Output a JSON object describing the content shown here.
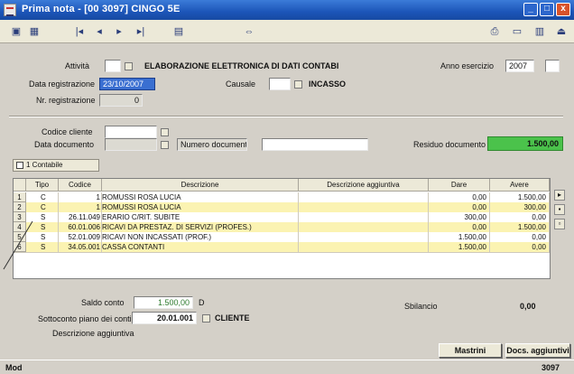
{
  "window": {
    "title": "Prima nota - [00 3097] CINGO 5E",
    "min_glyph": "_",
    "max_glyph": "□",
    "close_glyph": "x"
  },
  "toolbar": {
    "left_icons": [
      "save-icon",
      "window-icon",
      "first-record-icon",
      "previous-record-icon",
      "next-record-icon",
      "last-record-icon",
      "document-icon",
      "link-icon"
    ],
    "right_icons": [
      "print-icon",
      "preview-icon",
      "notes-icon",
      "exit-icon"
    ],
    "glyphs": {
      "save": "▣",
      "window": "▦",
      "first": "|◂",
      "prev": "◂",
      "next": "▸",
      "last": "▸|",
      "doc": "▤",
      "link": "⇔",
      "print": "⎙",
      "preview": "▭",
      "notes": "▥",
      "exit": "⏏"
    }
  },
  "header": {
    "attivita_label": "Attività",
    "attivita_value": "",
    "attivita_desc": "ELABORAZIONE ELETTRONICA DI DATI CONTABI",
    "anno_label": "Anno esercizio",
    "anno_value": "2007",
    "data_reg_label": "Data registrazione",
    "data_reg_value": "23/10/2007",
    "causale_label": "Causale",
    "causale_value": "",
    "causale_desc": "INCASSO",
    "nr_reg_label": "Nr. registrazione",
    "nr_reg_value": "0"
  },
  "cliente": {
    "codice_label": "Codice cliente",
    "codice_value": "",
    "data_doc_label": "Data documento",
    "data_doc_value": "",
    "numero_doc_label": "Numero documento",
    "numero_doc_value": "",
    "residuo_label": "Residuo documento",
    "residuo_value": "1.500,00"
  },
  "tab": {
    "label": "1 Contabile"
  },
  "grid": {
    "columns": [
      "Tipo",
      "Codice",
      "Descrizione",
      "Descrizione aggiuntiva",
      "Dare",
      "Avere"
    ],
    "rows": [
      {
        "num": "1",
        "tipo": "C",
        "codice": "1",
        "descrizione": "ROMUSSI ROSA LUCIA",
        "agg": "",
        "dare": "0,00",
        "avere": "1.500,00"
      },
      {
        "num": "2",
        "tipo": "C",
        "codice": "1",
        "descrizione": "ROMUSSI ROSA LUCIA",
        "agg": "",
        "dare": "0,00",
        "avere": "300,00"
      },
      {
        "num": "3",
        "tipo": "S",
        "codice": "26.11.049",
        "descrizione": "ERARIO C/RIT. SUBITE",
        "agg": "",
        "dare": "300,00",
        "avere": "0,00"
      },
      {
        "num": "4",
        "tipo": "S",
        "codice": "60.01.006",
        "descrizione": "RICAVI DA PRESTAZ. DI SERVIZI (PROFES.)",
        "agg": "",
        "dare": "0,00",
        "avere": "1.500,00"
      },
      {
        "num": "5",
        "tipo": "S",
        "codice": "52.01.009",
        "descrizione": "RICAVI NON INCASSATI (PROF.)",
        "agg": "",
        "dare": "1.500,00",
        "avere": "0,00"
      },
      {
        "num": "6",
        "tipo": "S",
        "codice": "34.05.001",
        "descrizione": "CASSA CONTANTI",
        "agg": "",
        "dare": "1.500,00",
        "avere": "0,00"
      }
    ]
  },
  "footer": {
    "saldo_label": "Saldo conto",
    "saldo_value": "1.500,00",
    "saldo_sign": "D",
    "sbilancio_label": "Sbilancio",
    "sbilancio_value": "0,00",
    "sottoconto_label": "Sottoconto piano dei conti",
    "sottoconto_value": "20.01.001",
    "sottoconto_desc": "CLIENTE",
    "desc_agg_label": "Descrizione aggiuntiva",
    "mastrini_label": "Mastrini",
    "docs_label": "Docs. aggiuntivi"
  },
  "status": {
    "left": "Mod",
    "right": "3097"
  },
  "colors": {
    "title_bar": "#1c55b8",
    "residuo_green": "#4bc24b",
    "row_yellow": "#fbf3b2",
    "selection_blue": "#3a6fd1"
  }
}
